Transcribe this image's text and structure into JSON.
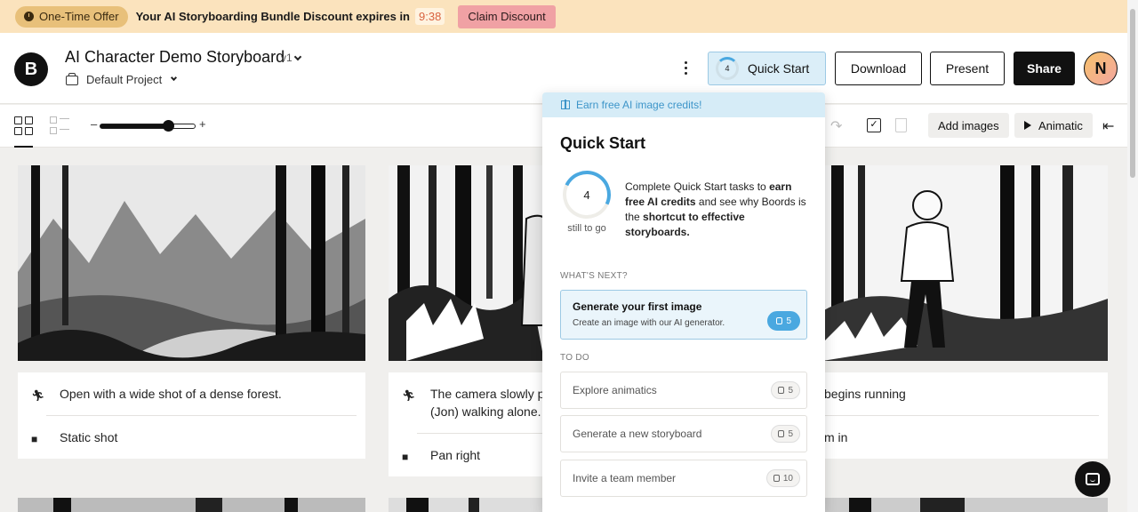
{
  "banner": {
    "offer_label": "One-Time Offer",
    "message": "Your AI Storyboarding Bundle Discount expires in",
    "countdown": "9:38",
    "claim_label": "Claim Discount"
  },
  "header": {
    "logo_letter": "B",
    "title": "AI Character Demo Storyboard",
    "version": "v1",
    "project": "Default Project",
    "quick_start_label": "Quick Start",
    "quick_start_count": "4",
    "download_label": "Download",
    "present_label": "Present",
    "share_label": "Share",
    "avatar_letter": "N"
  },
  "toolbar": {
    "zoom_minus": "–",
    "zoom_plus": "+",
    "zoom_level": 0.72,
    "add_images_label": "Add images",
    "animatic_label": "Animatic"
  },
  "boards": [
    {
      "action": "Open with a wide shot of a dense forest.",
      "camera": "Static shot"
    },
    {
      "action": "The camera slowly pa",
      "action_line2": "(Jon) walking alone.",
      "camera": "Pan right"
    },
    {
      "action": "begins running",
      "camera": "m in"
    }
  ],
  "popup": {
    "earn_label": "Earn free AI image credits!",
    "title": "Quick Start",
    "remaining": "4",
    "still_to_go": "still to go",
    "desc_1": "Complete Quick Start tasks to ",
    "desc_b1": "earn free AI credits",
    "desc_2": " and see why Boords is the ",
    "desc_b2": "shortcut to effective storyboards.",
    "whats_next_label": "WHAT'S NEXT?",
    "todo_label": "TO DO",
    "next_task": {
      "title": "Generate your first image",
      "subtitle": "Create an image with our AI generator.",
      "credits": "5"
    },
    "todo_tasks": [
      {
        "title": "Explore animatics",
        "credits": "5"
      },
      {
        "title": "Generate a new storyboard",
        "credits": "5"
      },
      {
        "title": "Invite a team member",
        "credits": "10"
      }
    ]
  },
  "colors": {
    "banner_bg": "#fbe3bd",
    "accent_blue": "#4aa8e0",
    "claim_pink": "#f0a1a4"
  }
}
